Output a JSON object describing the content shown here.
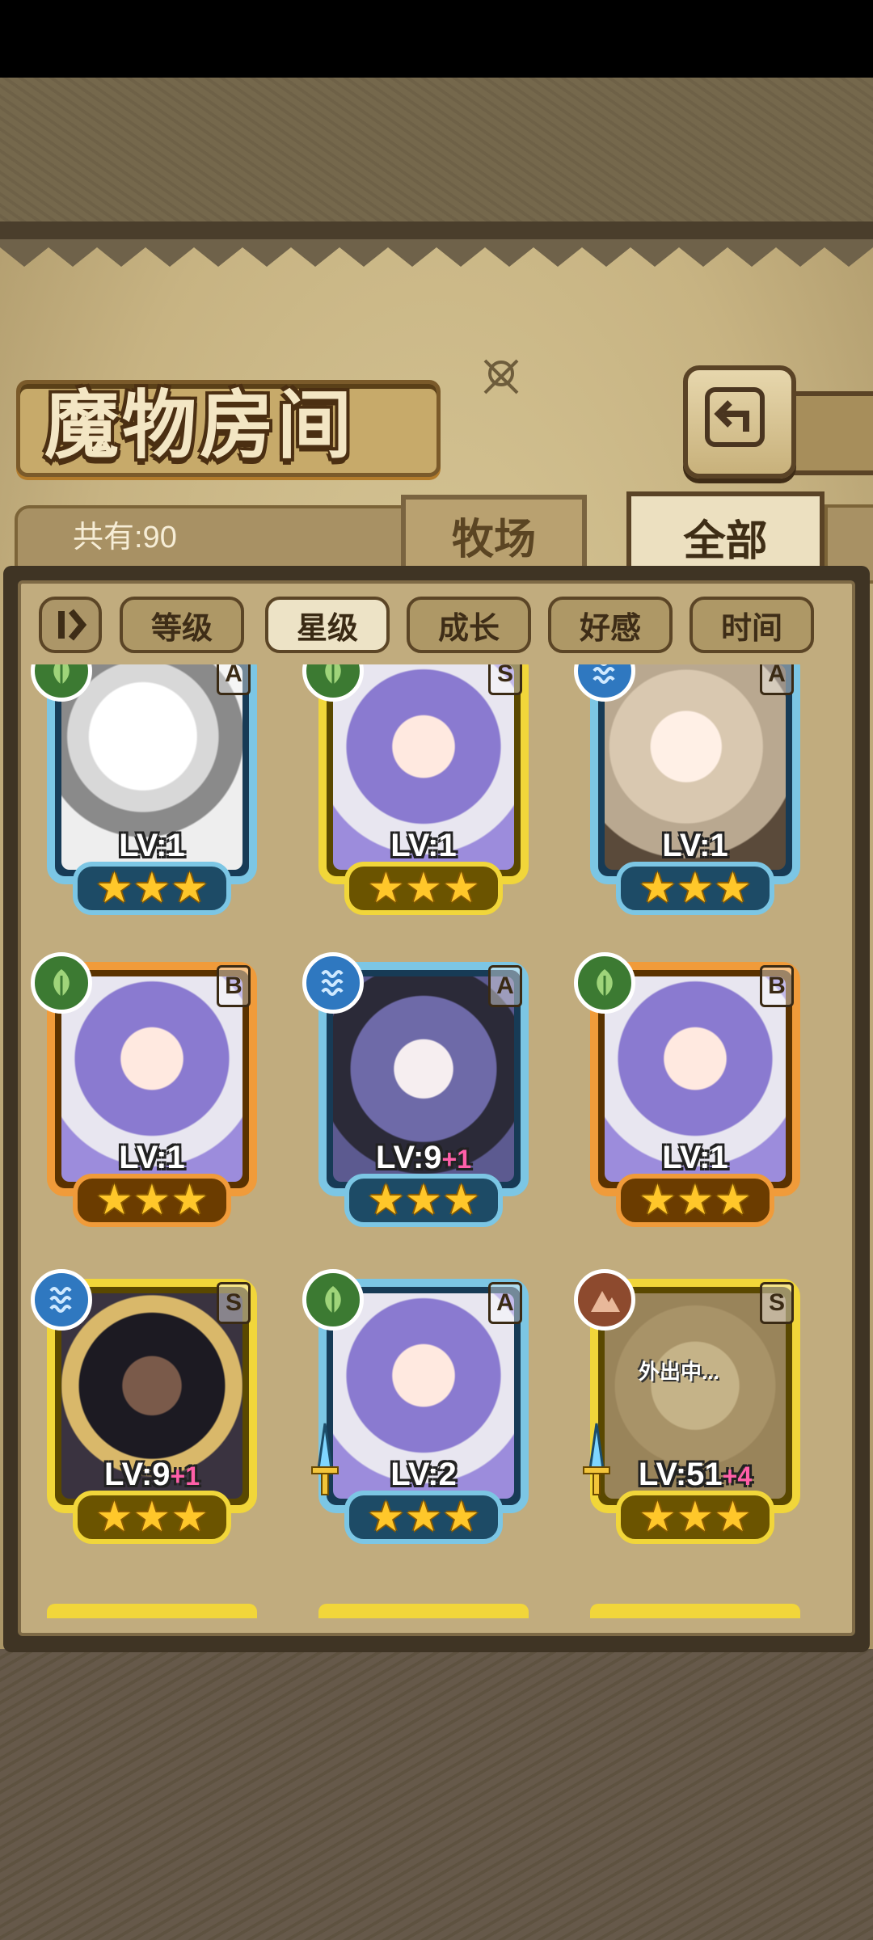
{
  "header": {
    "title": "魔物房间",
    "back_icon": "return-arrow-icon"
  },
  "count_label": "共有:90",
  "tabs": [
    {
      "label": "牧场",
      "active": false
    },
    {
      "label": "全部",
      "active": true
    }
  ],
  "sort": {
    "toggle_icon": "sort-order-icon",
    "buttons": [
      {
        "label": "等级",
        "active": false
      },
      {
        "label": "星级",
        "active": true
      },
      {
        "label": "成长",
        "active": false
      },
      {
        "label": "好感",
        "active": false
      },
      {
        "label": "时间",
        "active": false
      }
    ]
  },
  "monsters": [
    {
      "level": "LV:1",
      "bonus": "",
      "stars": "★★★",
      "rank": "A",
      "frame": "blue",
      "element": "leaf",
      "note": ""
    },
    {
      "level": "LV:1",
      "bonus": "",
      "stars": "★★★",
      "rank": "S",
      "frame": "gold",
      "element": "leaf",
      "note": ""
    },
    {
      "level": "LV:1",
      "bonus": "",
      "stars": "★★★",
      "rank": "A",
      "frame": "blue",
      "element": "water",
      "note": ""
    },
    {
      "level": "LV:1",
      "bonus": "",
      "stars": "★★★",
      "rank": "B",
      "frame": "orange",
      "element": "leaf",
      "note": ""
    },
    {
      "level": "LV:9",
      "bonus": "+1",
      "stars": "★★★",
      "rank": "A",
      "frame": "blue",
      "element": "water",
      "note": ""
    },
    {
      "level": "LV:1",
      "bonus": "",
      "stars": "★★★",
      "rank": "B",
      "frame": "orange",
      "element": "leaf",
      "note": ""
    },
    {
      "level": "LV:9",
      "bonus": "+1",
      "stars": "★★★",
      "rank": "S",
      "frame": "gold",
      "element": "water",
      "note": ""
    },
    {
      "level": "LV:2",
      "bonus": "",
      "stars": "★★★",
      "rank": "A",
      "frame": "blue",
      "element": "leaf",
      "note": ""
    },
    {
      "level": "LV:51",
      "bonus": "+4",
      "stars": "★★★",
      "rank": "S",
      "frame": "gold",
      "element": "rock",
      "note": "外出中..."
    }
  ]
}
